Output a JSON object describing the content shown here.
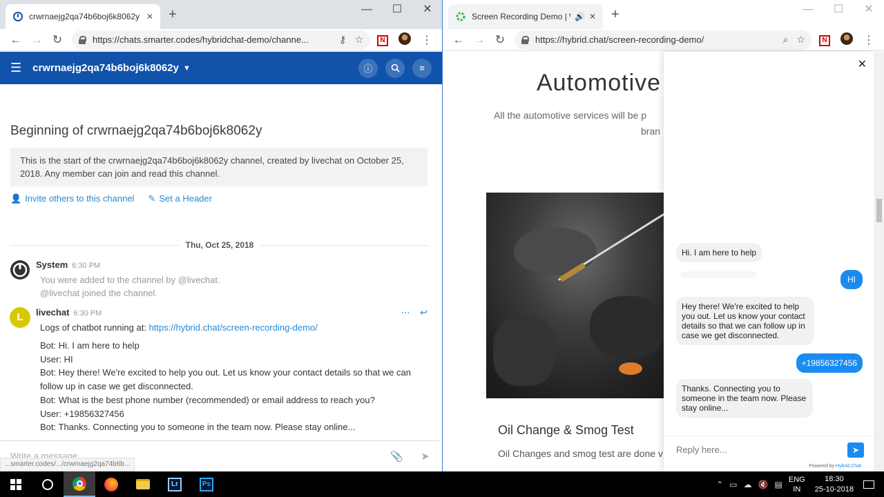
{
  "left_window": {
    "tab_title": "crwrnaejg2qa74b6boj6k8062y - I",
    "url": "https://chats.smarter.codes/hybridchat-demo/channe...",
    "window_controls": {
      "minimize": "—",
      "maximize": "☐",
      "close": "✕"
    },
    "mattermost": {
      "channel_name": "crwrnaejg2qa74b6boj6k8062y",
      "beginning_title": "Beginning of crwrnaejg2qa74b6boj6k8062y",
      "intro_text": "This is the start of the crwrnaejg2qa74b6boj6k8062y channel, created by livechat on October 25, 2018. Any member can join and read this channel.",
      "invite_label": "Invite others to this channel",
      "header_label": "Set a Header",
      "date_separator": "Thu, Oct 25, 2018",
      "system_post": {
        "author": "System",
        "time": "6:30 PM",
        "lines": [
          "You were added to the channel by @livechat.",
          "@livechat joined the channel."
        ]
      },
      "livechat_post": {
        "author": "livechat",
        "avatar_letter": "L",
        "time": "6:30 PM",
        "intro": "Logs of chatbot running at:",
        "link": "https://hybrid.chat/screen-recording-demo/",
        "lines": [
          "Bot: Hi. I am here to help",
          "User: HI",
          "Bot: Hey there! We're excited to help you out. Let us know your contact details so that we can",
          "follow up in case we get disconnected.",
          "Bot: What is the best phone number (recommended) or email address to reach you?",
          "User: +19856327456",
          "Bot: Thanks. Connecting you to someone in the team now. Please stay online..."
        ]
      },
      "composer_placeholder": "Write a message...",
      "status_url": "...smarter.codes/.../crwrnaejg2qa74b6b..."
    }
  },
  "right_window": {
    "tab_title": "Screen Recording Demo | W",
    "url": "https://hybrid.chat/screen-recording-demo/",
    "site": {
      "heading": "Automotive",
      "subtitle": "All the automotive services will be p",
      "subtitle2": "bran",
      "card_title": "Oil Change & Smog Test",
      "card_text": "Oil Changes and smog test are done v"
    },
    "chat_widget": {
      "messages": [
        {
          "from": "bot",
          "text": "Hi. I am here to help"
        },
        {
          "from": "user",
          "text": "HI"
        },
        {
          "from": "bot",
          "text": "Hey there! We're excited to help you out. Let us know your contact details so that we can follow up in case we get disconnected."
        },
        {
          "from": "user",
          "text": "+19856327456"
        },
        {
          "from": "bot",
          "text": "Thanks. Connecting you to someone in the team now. Please stay online..."
        }
      ],
      "input_placeholder": "Reply here...",
      "powered_by": "Powered by",
      "brand": "Hybrid.Chat"
    }
  },
  "taskbar": {
    "language": "ENG",
    "region": "IN",
    "time": "18:30",
    "date": "25-10-2018",
    "apps": [
      "start",
      "cortana",
      "chrome",
      "firefox",
      "file-explorer",
      "lightroom",
      "photoshop"
    ],
    "lr_label": "Lr",
    "ps_label": "Ps"
  },
  "colors": {
    "mattermost_header": "#1153ab",
    "link_blue": "#2389d7",
    "chat_user_bubble": "#1a8cf0"
  }
}
